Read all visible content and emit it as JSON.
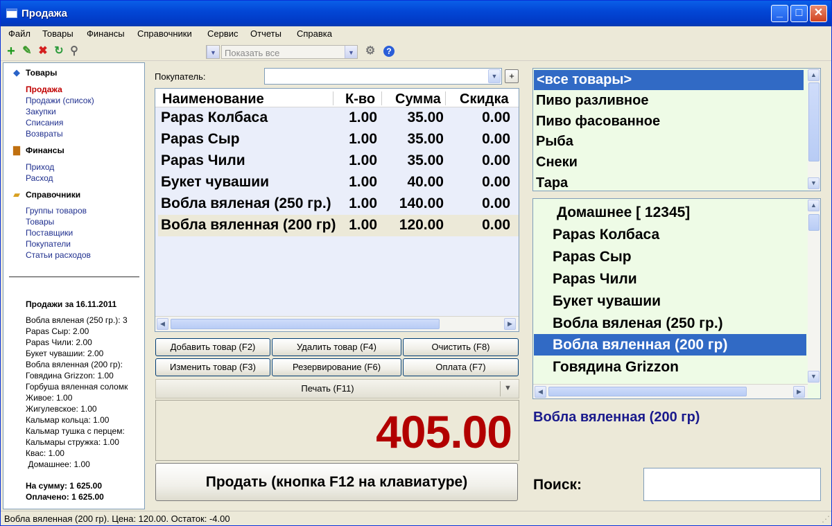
{
  "window": {
    "title": "Продажа",
    "min": "_",
    "max": "□",
    "close": "✕"
  },
  "menu": [
    "Файл",
    "Товары",
    "Финансы",
    "Справочники",
    "Сервис",
    "Отчеты",
    "Справка"
  ],
  "toolbar": {
    "filter_placeholder": "Показать все"
  },
  "sidebar": {
    "goods_header": "Товары",
    "goods_items": [
      "Продажа",
      "Продажи (список)",
      "Закупки",
      "Списания",
      "Возвраты"
    ],
    "finance_header": "Финансы",
    "finance_items": [
      "Приход",
      "Расход"
    ],
    "refs_header": "Справочники",
    "refs_items": [
      "Группы товаров",
      "Товары",
      "Поставщики",
      "Покупатели",
      "Статьи расходов"
    ],
    "sales_title": "Продажи за 16.11.2011",
    "sales_lines": [
      "Вобла вяленая (250 гр.): 3",
      "Papas Сыр: 2.00",
      "Papas Чили: 2.00",
      "Букет чувашии: 2.00",
      "Вобла вяленная (200 гр):",
      "Говядина Grizzon: 1.00",
      "Горбуша вяленная соломк",
      "Живое: 1.00",
      "Жигулевское: 1.00",
      "Кальмар кольца: 1.00",
      "Кальмар тушка с перцем:",
      "Кальмары стружка: 1.00",
      "Квас: 1.00",
      " Домашнее: 1.00"
    ],
    "total_sum": "На сумму: 1 625.00",
    "paid": "Оплачено: 1 625.00"
  },
  "buyer_label": "Покупатель:",
  "buyer_value": "",
  "plus": "+",
  "table": {
    "columns": [
      "Наименование",
      "К-во",
      "Сумма",
      "Скидка"
    ],
    "rows": [
      {
        "name": "Papas Колбаса",
        "qty": "1.00",
        "sum": "35.00",
        "disc": "0.00"
      },
      {
        "name": "Papas Сыр",
        "qty": "1.00",
        "sum": "35.00",
        "disc": "0.00"
      },
      {
        "name": "Papas Чили",
        "qty": "1.00",
        "sum": "35.00",
        "disc": "0.00"
      },
      {
        "name": "Букет чувашии",
        "qty": "1.00",
        "sum": "40.00",
        "disc": "0.00"
      },
      {
        "name": "Вобла вяленая (250 гр.)",
        "qty": "1.00",
        "sum": "140.00",
        "disc": "0.00"
      },
      {
        "name": "Вобла вяленная (200 гр)",
        "qty": "1.00",
        "sum": "120.00",
        "disc": "0.00"
      }
    ]
  },
  "buttons": {
    "add": "Добавить товар (F2)",
    "delete": "Удалить товар (F4)",
    "clear": "Очистить (F8)",
    "edit": "Изменить товар (F3)",
    "reserve": "Резервирование (F6)",
    "pay": "Оплата (F7)",
    "print": "Печать (F11)",
    "sell": "Продать (кнопка F12 на клавиатуре)"
  },
  "total": "405.00",
  "categories": [
    "<все товары>",
    "Пиво разливное",
    "Пиво фасованное",
    "Рыба",
    "Снеки",
    "Тара"
  ],
  "products": [
    "Домашнее [ 12345]",
    "Papas Колбаса",
    "Papas Сыр",
    "Papas Чили",
    "Букет чувашии",
    "Вобла вяленая (250 гр.)",
    "Вобла вяленная (200 гр)",
    "Говядина Grizzon"
  ],
  "selected_product": "Вобла вяленная (200 гр)",
  "search_label": "Поиск:",
  "search_value": "",
  "status": "Вобла вяленная (200 гр). Цена: 120.00. Остаток: -4.00",
  "colors": {
    "selection": "#316ac5",
    "total": "#b20000",
    "selected_name": "#1a1a8c",
    "list_bg": "#eefbe6"
  }
}
